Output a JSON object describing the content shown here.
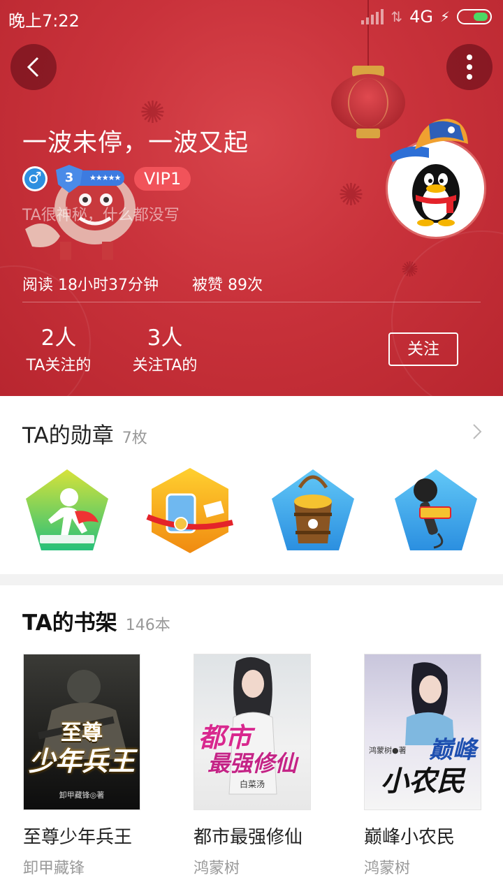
{
  "status_bar": {
    "time": "晚上7:22",
    "network": "4G"
  },
  "header": {
    "title": "一波未停，一波又起",
    "level": "3",
    "level_stars": "★★★★★",
    "vip": "VIP1",
    "bio": "TA很神秘，什么都没写",
    "reading": "阅读 18小时37分钟",
    "likes": "被赞 89次",
    "following_count": "2人",
    "following_label": "TA关注的",
    "followers_count": "3人",
    "followers_label": "关注TA的",
    "follow_button": "关注",
    "gender_icon": "male-icon"
  },
  "medals": {
    "title": "TA的勋章",
    "count": "7枚",
    "items": [
      {
        "icon": "runner-medal-icon",
        "color": "#4cc86a"
      },
      {
        "icon": "champion-medal-icon",
        "color": "#f5a623"
      },
      {
        "icon": "gold-bucket-medal-icon",
        "color": "#3aa7e8"
      },
      {
        "icon": "microphone-medal-icon",
        "color": "#3aa7e8"
      }
    ]
  },
  "shelf": {
    "title": "TA的书架",
    "count": "146本",
    "books": [
      {
        "title": "至尊少年兵王",
        "author": "卸甲藏锋",
        "cover_line1": "至尊",
        "cover_line2": "少年兵王",
        "cover_credit": "卸甲藏锋◎著"
      },
      {
        "title": "都市最强修仙",
        "author": "鸿蒙树",
        "cover_line1": "都市",
        "cover_line2": "最强修仙",
        "cover_credit": "白菜汤"
      },
      {
        "title": "巅峰小农民",
        "author": "鸿蒙树",
        "cover_line1": "巅峰",
        "cover_line2": "小农民",
        "cover_credit": "鸿蒙树●著"
      }
    ]
  }
}
